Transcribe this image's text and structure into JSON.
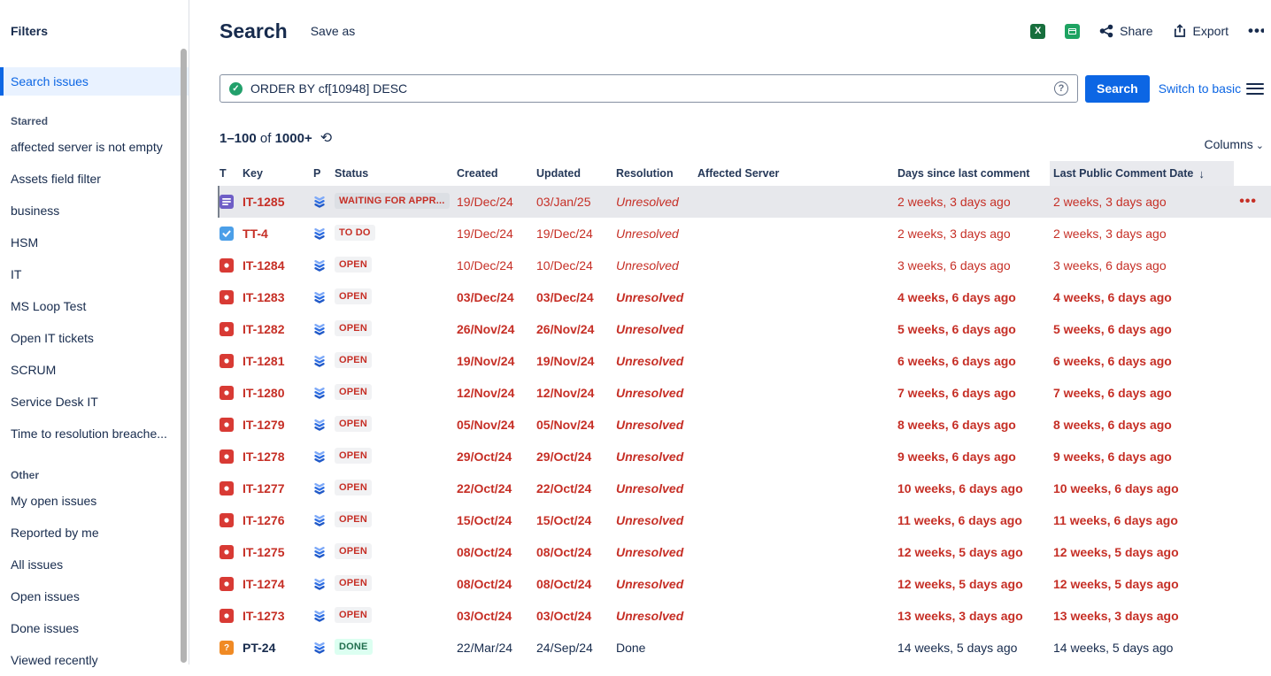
{
  "sidebar": {
    "title": "Filters",
    "selected_item": "Search issues",
    "sections": [
      {
        "label": "Starred",
        "items": [
          "affected server is not empty",
          "Assets field filter",
          "business",
          "HSM",
          "IT",
          "MS Loop Test",
          "Open IT tickets",
          "SCRUM",
          "Service Desk IT",
          "Time to resolution breache..."
        ]
      },
      {
        "label": "Other",
        "items": [
          "My open issues",
          "Reported by me",
          "All issues",
          "Open issues",
          "Done issues",
          "Viewed recently"
        ]
      }
    ]
  },
  "header": {
    "title": "Search",
    "save_as": "Save as",
    "share_label": "Share",
    "export_label": "Export",
    "more_label": "•••",
    "excel_icon": "excel-export-icon",
    "sheets_icon": "google-sheets-export-icon"
  },
  "search": {
    "query": "ORDER BY cf[10948] DESC",
    "button_label": "Search",
    "switch_label": "Switch to basic",
    "valid_color": "#22a06b"
  },
  "results": {
    "range": "1–100",
    "of_word": "of",
    "total": "1000+",
    "columns_label": "Columns"
  },
  "table": {
    "headers": [
      "T",
      "Key",
      "P",
      "Status",
      "Created",
      "Updated",
      "Resolution",
      "Affected Server",
      "Days since last comment",
      "Last Public Comment Date"
    ],
    "sorted_header": "Last Public Comment Date",
    "sort_arrow": "↓",
    "priority_icon": "priority-lowest-icon",
    "colors": {
      "red_text": "#c62f26",
      "selected_row_bg": "#e7e8ec",
      "accent_blue": "#0c66e4"
    },
    "rows": [
      {
        "type": "request",
        "key": "IT-1285",
        "status": "WAITING FOR APPR...",
        "status_kind": "default",
        "created": "19/Dec/24",
        "updated": "03/Jan/25",
        "resolution": "Unresolved",
        "affected_server": "",
        "days_since": "2 weeks, 3 days ago",
        "last_public": "2 weeks, 3 days ago",
        "tone": "red",
        "weight": "normal",
        "selected": true,
        "more_label": "•••"
      },
      {
        "type": "task",
        "key": "TT-4",
        "status": "TO DO",
        "status_kind": "default",
        "created": "19/Dec/24",
        "updated": "19/Dec/24",
        "resolution": "Unresolved",
        "affected_server": "",
        "days_since": "2 weeks, 3 days ago",
        "last_public": "2 weeks, 3 days ago",
        "tone": "red",
        "weight": "normal",
        "selected": false
      },
      {
        "type": "incident",
        "key": "IT-1284",
        "status": "OPEN",
        "status_kind": "default",
        "created": "10/Dec/24",
        "updated": "10/Dec/24",
        "resolution": "Unresolved",
        "affected_server": "",
        "days_since": "3 weeks, 6 days ago",
        "last_public": "3 weeks, 6 days ago",
        "tone": "red",
        "weight": "normal",
        "selected": false
      },
      {
        "type": "incident",
        "key": "IT-1283",
        "status": "OPEN",
        "status_kind": "default",
        "created": "03/Dec/24",
        "updated": "03/Dec/24",
        "resolution": "Unresolved",
        "affected_server": "",
        "days_since": "4 weeks, 6 days ago",
        "last_public": "4 weeks, 6 days ago",
        "tone": "red",
        "weight": "bold",
        "selected": false
      },
      {
        "type": "incident",
        "key": "IT-1282",
        "status": "OPEN",
        "status_kind": "default",
        "created": "26/Nov/24",
        "updated": "26/Nov/24",
        "resolution": "Unresolved",
        "affected_server": "",
        "days_since": "5 weeks, 6 days ago",
        "last_public": "5 weeks, 6 days ago",
        "tone": "red",
        "weight": "bold",
        "selected": false
      },
      {
        "type": "incident",
        "key": "IT-1281",
        "status": "OPEN",
        "status_kind": "default",
        "created": "19/Nov/24",
        "updated": "19/Nov/24",
        "resolution": "Unresolved",
        "affected_server": "",
        "days_since": "6 weeks, 6 days ago",
        "last_public": "6 weeks, 6 days ago",
        "tone": "red",
        "weight": "bold",
        "selected": false
      },
      {
        "type": "incident",
        "key": "IT-1280",
        "status": "OPEN",
        "status_kind": "default",
        "created": "12/Nov/24",
        "updated": "12/Nov/24",
        "resolution": "Unresolved",
        "affected_server": "",
        "days_since": "7 weeks, 6 days ago",
        "last_public": "7 weeks, 6 days ago",
        "tone": "red",
        "weight": "bold",
        "selected": false
      },
      {
        "type": "incident",
        "key": "IT-1279",
        "status": "OPEN",
        "status_kind": "default",
        "created": "05/Nov/24",
        "updated": "05/Nov/24",
        "resolution": "Unresolved",
        "affected_server": "",
        "days_since": "8 weeks, 6 days ago",
        "last_public": "8 weeks, 6 days ago",
        "tone": "red",
        "weight": "bold",
        "selected": false
      },
      {
        "type": "incident",
        "key": "IT-1278",
        "status": "OPEN",
        "status_kind": "default",
        "created": "29/Oct/24",
        "updated": "29/Oct/24",
        "resolution": "Unresolved",
        "affected_server": "",
        "days_since": "9 weeks, 6 days ago",
        "last_public": "9 weeks, 6 days ago",
        "tone": "red",
        "weight": "bold",
        "selected": false
      },
      {
        "type": "incident",
        "key": "IT-1277",
        "status": "OPEN",
        "status_kind": "default",
        "created": "22/Oct/24",
        "updated": "22/Oct/24",
        "resolution": "Unresolved",
        "affected_server": "",
        "days_since": "10 weeks, 6 days ago",
        "last_public": "10 weeks, 6 days ago",
        "tone": "red",
        "weight": "bold",
        "selected": false
      },
      {
        "type": "incident",
        "key": "IT-1276",
        "status": "OPEN",
        "status_kind": "default",
        "created": "15/Oct/24",
        "updated": "15/Oct/24",
        "resolution": "Unresolved",
        "affected_server": "",
        "days_since": "11 weeks, 6 days ago",
        "last_public": "11 weeks, 6 days ago",
        "tone": "red",
        "weight": "bold",
        "selected": false
      },
      {
        "type": "incident",
        "key": "IT-1275",
        "status": "OPEN",
        "status_kind": "default",
        "created": "08/Oct/24",
        "updated": "08/Oct/24",
        "resolution": "Unresolved",
        "affected_server": "",
        "days_since": "12 weeks, 5 days ago",
        "last_public": "12 weeks, 5 days ago",
        "tone": "red",
        "weight": "bold",
        "selected": false
      },
      {
        "type": "incident",
        "key": "IT-1274",
        "status": "OPEN",
        "status_kind": "default",
        "created": "08/Oct/24",
        "updated": "08/Oct/24",
        "resolution": "Unresolved",
        "affected_server": "",
        "days_since": "12 weeks, 5 days ago",
        "last_public": "12 weeks, 5 days ago",
        "tone": "red",
        "weight": "bold",
        "selected": false
      },
      {
        "type": "incident",
        "key": "IT-1273",
        "status": "OPEN",
        "status_kind": "default",
        "created": "03/Oct/24",
        "updated": "03/Oct/24",
        "resolution": "Unresolved",
        "affected_server": "",
        "days_since": "13 weeks, 3 days ago",
        "last_public": "13 weeks, 3 days ago",
        "tone": "red",
        "weight": "bold",
        "selected": false
      },
      {
        "type": "question",
        "key": "PT-24",
        "status": "DONE",
        "status_kind": "green",
        "created": "22/Mar/24",
        "updated": "24/Sep/24",
        "resolution": "Done",
        "affected_server": "",
        "days_since": "14 weeks, 5 days ago",
        "last_public": "14 weeks, 5 days ago",
        "tone": "plain",
        "weight": "normal",
        "selected": false
      }
    ]
  }
}
